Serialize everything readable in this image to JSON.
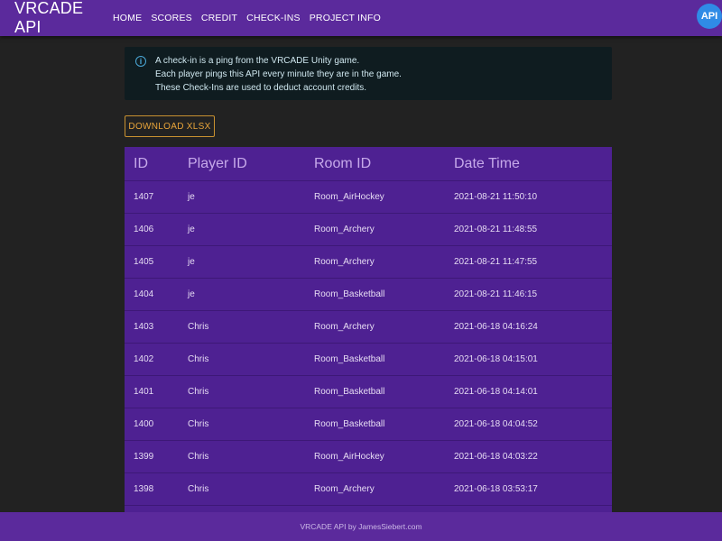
{
  "header": {
    "brand": "VRCADE API",
    "nav": [
      "HOME",
      "SCORES",
      "CREDIT",
      "CHECK-INS",
      "PROJECT INFO"
    ],
    "badge": "API"
  },
  "info": {
    "lines": [
      "A check-in is a ping from the VRCADE Unity game.",
      "Each player pings this API every minute they are in the game.",
      "These Check-Ins are used to deduct account credits."
    ]
  },
  "download_label": "DOWNLOAD XLSX",
  "table": {
    "columns": [
      "ID",
      "Player ID",
      "Room ID",
      "Date Time"
    ],
    "rows": [
      [
        "1407",
        "je",
        "Room_AirHockey",
        "2021-08-21 11:50:10"
      ],
      [
        "1406",
        "je",
        "Room_Archery",
        "2021-08-21 11:48:55"
      ],
      [
        "1405",
        "je",
        "Room_Archery",
        "2021-08-21 11:47:55"
      ],
      [
        "1404",
        "je",
        "Room_Basketball",
        "2021-08-21 11:46:15"
      ],
      [
        "1403",
        "Chris",
        "Room_Archery",
        "2021-06-18 04:16:24"
      ],
      [
        "1402",
        "Chris",
        "Room_Basketball",
        "2021-06-18 04:15:01"
      ],
      [
        "1401",
        "Chris",
        "Room_Basketball",
        "2021-06-18 04:14:01"
      ],
      [
        "1400",
        "Chris",
        "Room_Basketball",
        "2021-06-18 04:04:52"
      ],
      [
        "1399",
        "Chris",
        "Room_AirHockey",
        "2021-06-18 04:03:22"
      ],
      [
        "1398",
        "Chris",
        "Room_Archery",
        "2021-06-18 03:53:17"
      ]
    ]
  },
  "footer": "VRCADE API by JamesSiebert.com",
  "colors": {
    "navbar": "#5b2a9c",
    "table_bg": "#4e2192",
    "page_bg": "#222222",
    "info_bg": "#0f1c20",
    "accent": "#e9a53a"
  }
}
